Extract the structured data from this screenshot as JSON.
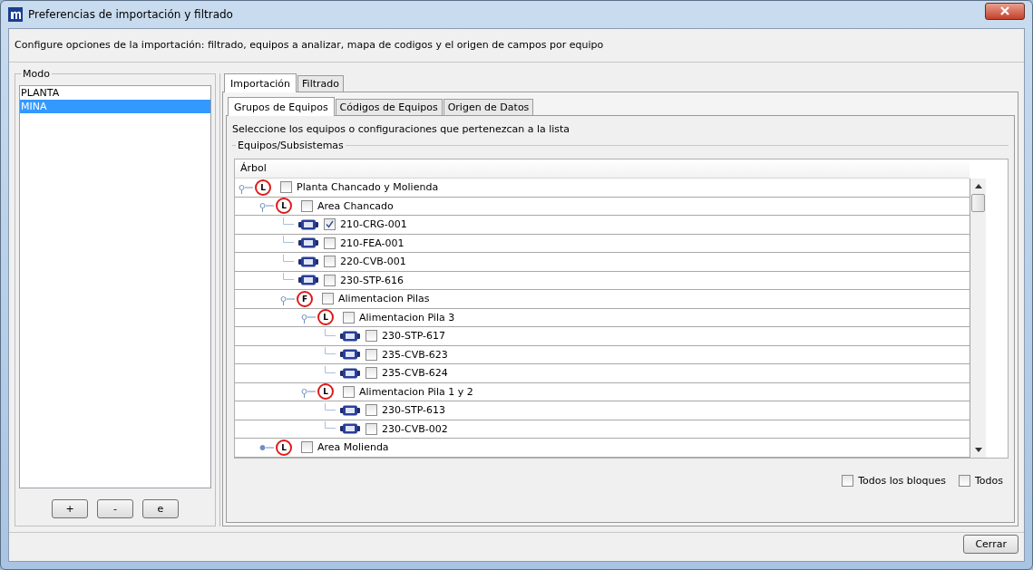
{
  "window": {
    "title": "Preferencias de importación y filtrado"
  },
  "description": "Configure opciones de la importación: filtrado, equipos a analizar, mapa de codigos y el origen de campos por equipo",
  "modes": {
    "label": "Modo",
    "items": [
      {
        "label": "PLANTA",
        "selected": false
      },
      {
        "label": "MINA",
        "selected": true
      }
    ],
    "buttons": [
      "+",
      "-",
      "e"
    ]
  },
  "tabs": [
    {
      "label": "Importación",
      "selected": true
    },
    {
      "label": "Filtrado",
      "selected": false
    }
  ],
  "subtabs": [
    {
      "label": "Grupos de Equipos",
      "selected": true
    },
    {
      "label": "Códigos de Equipos",
      "selected": false
    },
    {
      "label": "Origen de Datos",
      "selected": false
    }
  ],
  "instruction": "Seleccione los equipos o configuraciones que pertenezcan a la lista",
  "group_label": "Equipos/Subsistemas",
  "tree": {
    "column": "Árbol",
    "nodes": [
      {
        "label": "Planta Chancado y Molienda",
        "kind": "group",
        "badge": "L",
        "expanded": true,
        "checked": false,
        "children": [
          {
            "label": "Area Chancado",
            "kind": "group",
            "badge": "L",
            "expanded": true,
            "checked": false,
            "children": [
              {
                "label": "210-CRG-001",
                "kind": "equipment",
                "checked": true
              },
              {
                "label": "210-FEA-001",
                "kind": "equipment",
                "checked": false
              },
              {
                "label": "220-CVB-001",
                "kind": "equipment",
                "checked": false
              },
              {
                "label": "230-STP-616",
                "kind": "equipment",
                "checked": false
              },
              {
                "label": "Alimentacion Pilas",
                "kind": "group",
                "badge": "F",
                "expanded": true,
                "checked": false,
                "children": [
                  {
                    "label": "Alimentacion Pila 3",
                    "kind": "group",
                    "badge": "L",
                    "expanded": true,
                    "checked": false,
                    "children": [
                      {
                        "label": "230-STP-617",
                        "kind": "equipment",
                        "checked": false
                      },
                      {
                        "label": "235-CVB-623",
                        "kind": "equipment",
                        "checked": false
                      },
                      {
                        "label": "235-CVB-624",
                        "kind": "equipment",
                        "checked": false
                      }
                    ]
                  },
                  {
                    "label": "Alimentacion Pila 1 y 2",
                    "kind": "group",
                    "badge": "L",
                    "expanded": true,
                    "checked": false,
                    "children": [
                      {
                        "label": "230-STP-613",
                        "kind": "equipment",
                        "checked": false
                      },
                      {
                        "label": "230-CVB-002",
                        "kind": "equipment",
                        "checked": false
                      }
                    ]
                  }
                ]
              }
            ]
          },
          {
            "label": "Area Molienda",
            "kind": "group",
            "badge": "L",
            "expanded": false,
            "checked": false
          }
        ]
      }
    ]
  },
  "options": [
    {
      "label": "Todos los bloques",
      "checked": false
    },
    {
      "label": "Todos",
      "checked": false
    }
  ],
  "close_button": "Cerrar"
}
